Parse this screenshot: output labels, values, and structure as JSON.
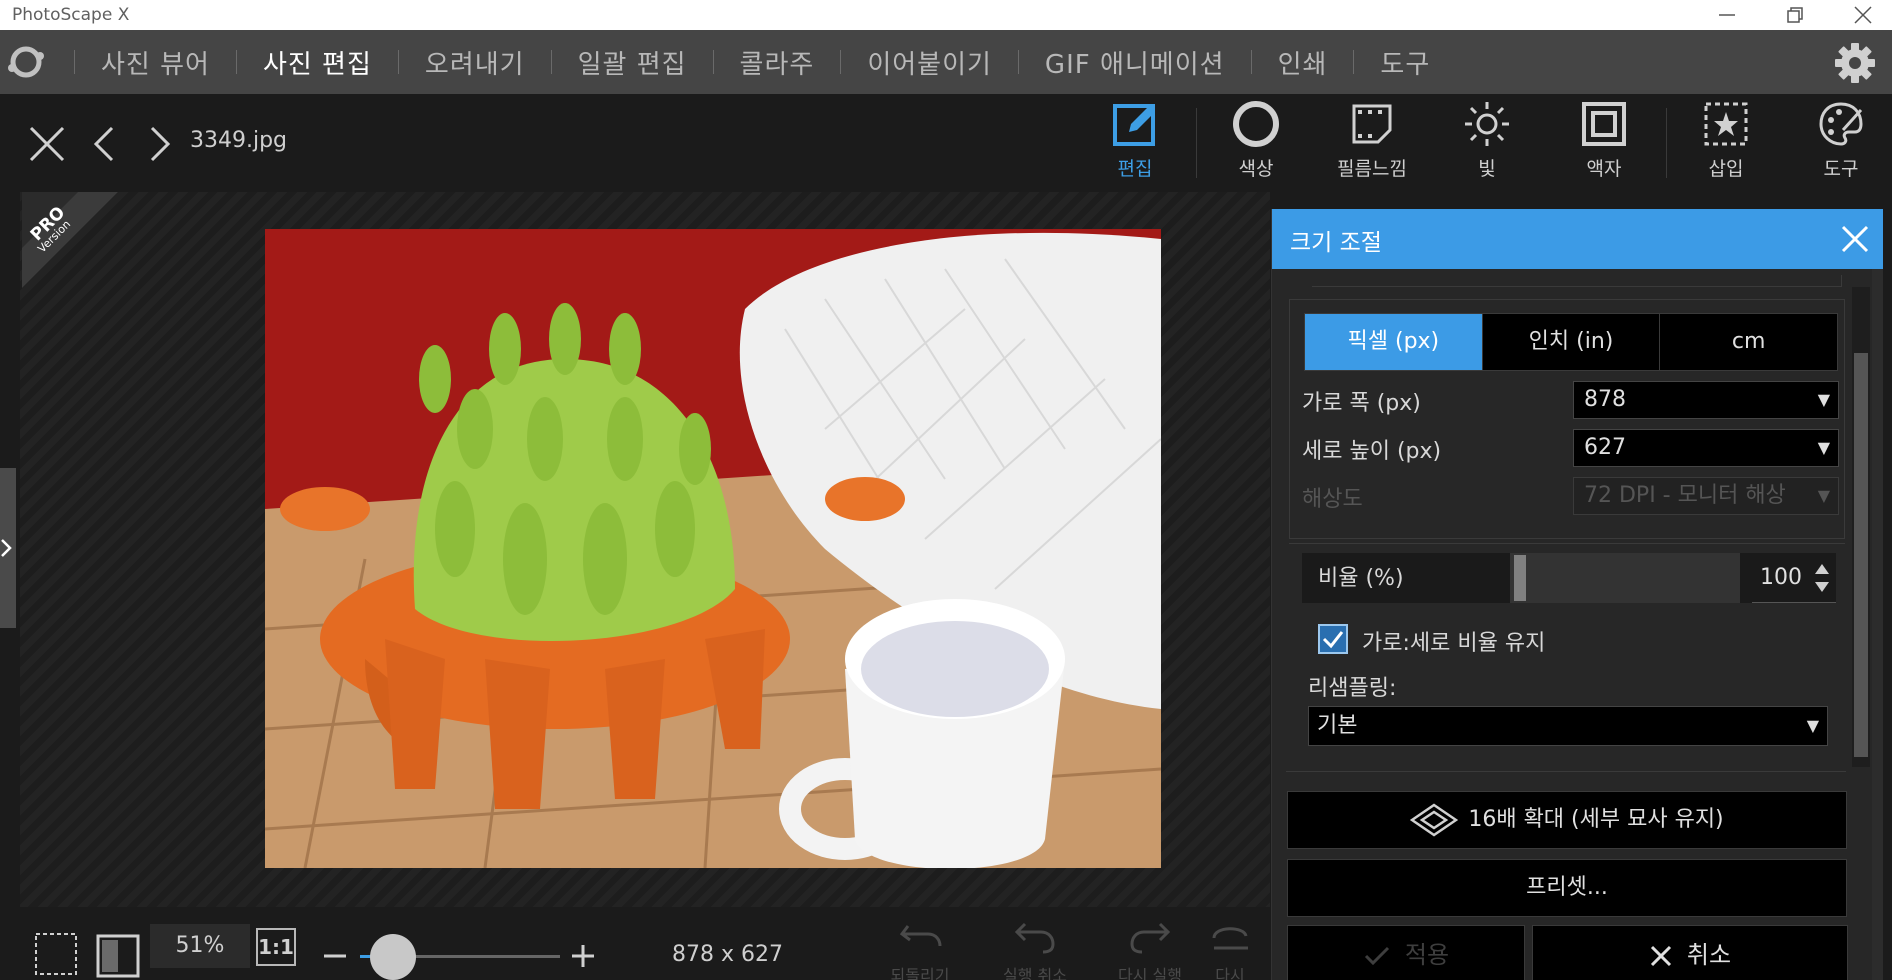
{
  "window": {
    "title": "PhotoScape X"
  },
  "menu": {
    "items": [
      {
        "label": "사진 뷰어",
        "active": false
      },
      {
        "label": "사진 편집",
        "active": true
      },
      {
        "label": "오려내기",
        "active": false
      },
      {
        "label": "일괄 편집",
        "active": false
      },
      {
        "label": "콜라주",
        "active": false
      },
      {
        "label": "이어붙이기",
        "active": false
      },
      {
        "label": "GIF 애니메이션",
        "active": false
      },
      {
        "label": "인쇄",
        "active": false
      },
      {
        "label": "도구",
        "active": false
      }
    ]
  },
  "toolbar": {
    "filename": "3349.jpg",
    "tools": [
      {
        "label": "편집",
        "icon": "edit-icon",
        "active": true
      },
      {
        "label": "색상",
        "icon": "color-icon",
        "active": false
      },
      {
        "label": "필름느낌",
        "icon": "film-icon",
        "active": false
      },
      {
        "label": "빛",
        "icon": "light-icon",
        "active": false
      },
      {
        "label": "액자",
        "icon": "frame-icon",
        "active": false
      },
      {
        "label": "삽입",
        "icon": "insert-icon",
        "active": false
      },
      {
        "label": "도구",
        "icon": "tools-icon",
        "active": false
      }
    ]
  },
  "badge": {
    "line1": "PRO",
    "line2": "Version"
  },
  "bottom": {
    "zoom": "51%",
    "one_to_one": "1:1",
    "zoom_level": 0.18,
    "dimensions": "878 x 627",
    "actions": [
      {
        "label": "되돌리기"
      },
      {
        "label": "실행 취소"
      },
      {
        "label": "다시 실행"
      },
      {
        "label": "다시"
      }
    ]
  },
  "panel": {
    "title": "크기 조절",
    "units": [
      {
        "label": "픽셀 (px)",
        "active": true
      },
      {
        "label": "인치 (in)",
        "active": false
      },
      {
        "label": "cm",
        "active": false
      }
    ],
    "width_label": "가로 폭 (px)",
    "width_value": "878",
    "height_label": "세로 높이 (px)",
    "height_value": "627",
    "dpi_label": "해상도",
    "dpi_value": "72 DPI - 모니터 해상",
    "ratio_label": "비율 (%)",
    "ratio_value": "100",
    "keep_ratio_label": "가로:세로 비율 유지",
    "keep_ratio_checked": true,
    "resampling_label": "리샘플링:",
    "resampling_value": "기본",
    "upscale_label": "16배 확대 (세부 묘사 유지)",
    "preset_label": "프리셋...",
    "apply_label": "적용",
    "cancel_label": "취소"
  },
  "colors": {
    "accent": "#3c9be6",
    "menubar": "#454545",
    "background": "#1b1b1b"
  }
}
